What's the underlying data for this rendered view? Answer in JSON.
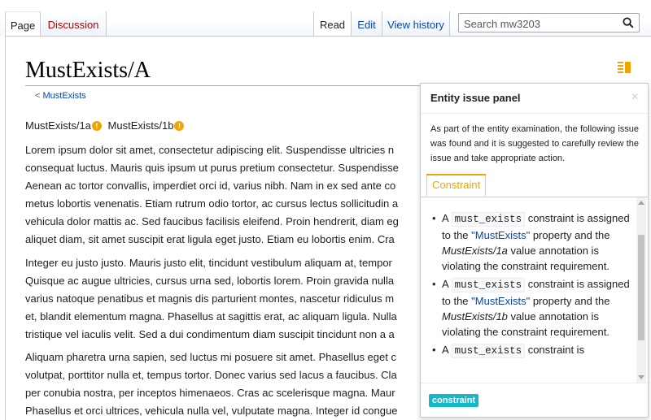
{
  "tabs": {
    "page": "Page",
    "discussion": "Discussion",
    "read": "Read",
    "edit": "Edit",
    "history": "View history"
  },
  "search": {
    "placeholder": "Search mw3203",
    "icon": "search-icon"
  },
  "page": {
    "title": "MustExists/A",
    "subpage_link": "MustExists",
    "subpage_prefix": "<",
    "links": [
      {
        "label": "MustExists/1a",
        "badge": "!"
      },
      {
        "label": "MustExists/1b",
        "badge": "!"
      }
    ],
    "paragraphs": [
      [
        "Lorem ipsum dolor sit amet, consectetur adipiscing elit. Suspendisse ultricies n",
        "consequat luctus. Mauris quis ipsum ut purus pretium consectetur. Suspendisse",
        "Aenean ac tortor convallis, imperdiet orci id, varius nibh. Nam in ex sed ante co",
        "metus lobortis venenatis. Etiam rutrum odio tortor, ac cursus lectus sollicitudin a",
        "vehicula dolor mattis ac. Sed faucibus facilisis eleifend. Proin hendrerit, diam eg",
        "aliquet diam, sit amet suscipit erat ligula eget justo. Etiam eu lobortis enim. Cra"
      ],
      [
        "Integer eu justo justo. Mauris justo elit, tincidunt vestibulum aliquam at, tempor",
        "Quisque ac augue ultricies, cursus urna sed, lobortis lorem. Proin gravida nulla",
        "varius natoque penatibus et magnis dis parturient montes, nascetur ridiculus m",
        "et, blandit elementum magna. Phasellus at sagittis erat, ac aliquam ligula. Nulla",
        "tristique vel iaculis velit. Sed a dui condimentum diam suscipit tincidunt non a a"
      ],
      [
        "Aliquam pharetra urna sapien, sed luctus mi posuere sit amet. Phasellus eget c",
        "volutpat, porttitor nulla et, tempus tortor. Donec varius sed lacus a faucibus. Cla",
        "per conubia nostra, per inceptos himenaeos. Cras ac scelerisque magna. Maur",
        "Phasellus et orci ultrices, vehicula nulla vel, vulputate magna. Integer id congue"
      ]
    ]
  },
  "panel": {
    "title": "Entity issue panel",
    "close": "×",
    "intro": "As part of the entity examination, the following issue was found and it is suggested to carefully review the issue and take appropriate action.",
    "tab": "Constraint",
    "items": [
      {
        "pre": "A ",
        "code": "must_exists",
        "mid": " constraint is assigned to the ",
        "link": "\"MustExists\"",
        "mid2": " property and the ",
        "ital": "MustExists/1a",
        "post": " value annotation is violating the constraint requirement."
      },
      {
        "pre": "A ",
        "code": "must_exists",
        "mid": " constraint is assigned to the ",
        "link": "\"MustExists\"",
        "mid2": " property and the ",
        "ital": "MustExists/1b",
        "post": " value annotation is violating the constraint requirement."
      },
      {
        "pre": "A ",
        "code": "must_exists",
        "mid": " constraint is",
        "link": "",
        "mid2": "",
        "ital": "",
        "post": ""
      }
    ],
    "badge": "constraint"
  },
  "colors": {
    "accent": "#f0a400",
    "link": "#0645ad",
    "redlink": "#ba0000",
    "badge": "#14b8c8"
  }
}
